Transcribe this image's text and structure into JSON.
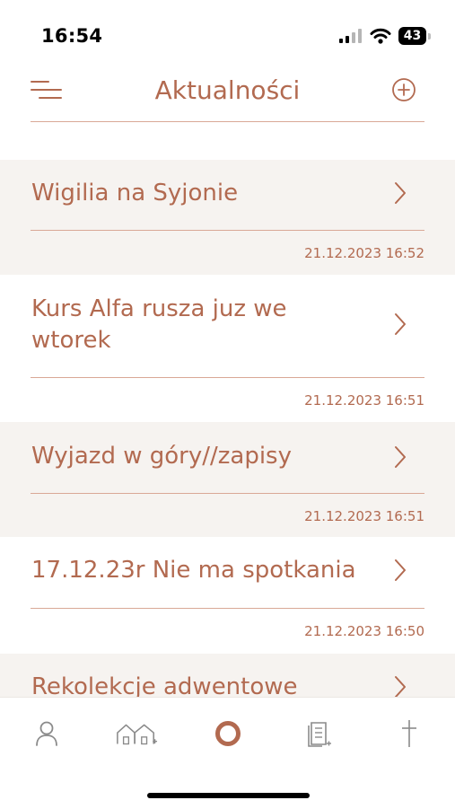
{
  "status": {
    "time": "16:54",
    "battery": "43"
  },
  "header": {
    "title": "Aktualności"
  },
  "news": [
    {
      "title": "Wigilia na Syjonie",
      "date": "21.12.2023 16:52"
    },
    {
      "title": "Kurs Alfa rusza juz we wtorek",
      "date": "21.12.2023 16:51"
    },
    {
      "title": "Wyjazd w góry//zapisy",
      "date": "21.12.2023 16:51"
    },
    {
      "title": "17.12.23r Nie ma spotkania",
      "date": "21.12.2023 16:50"
    },
    {
      "title": "Rekolekcje adwentowe",
      "date": ""
    }
  ],
  "tabs": [
    {
      "icon": "person-icon",
      "active": false
    },
    {
      "icon": "houses-icon",
      "active": false
    },
    {
      "icon": "ring-icon",
      "active": true
    },
    {
      "icon": "document-icon",
      "active": false
    },
    {
      "icon": "cross-icon",
      "active": false
    }
  ],
  "colors": {
    "accent": "#b26a50",
    "divider": "#d9a896",
    "shaded_row": "#f6f3f0",
    "inactive_icon": "#8a8a8a"
  }
}
